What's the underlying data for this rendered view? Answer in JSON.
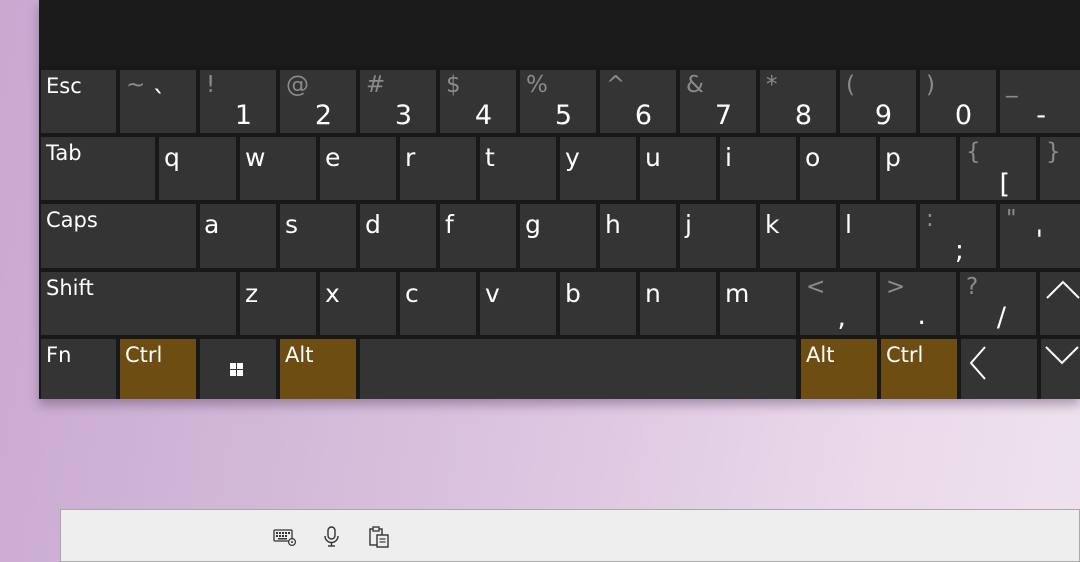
{
  "keyboard": {
    "row1": {
      "esc": "Esc",
      "tilde": {
        "shift": "~",
        "main": "`"
      },
      "k1": {
        "shift": "!",
        "main": "1"
      },
      "k2": {
        "shift": "@",
        "main": "2"
      },
      "k3": {
        "shift": "#",
        "main": "3"
      },
      "k4": {
        "shift": "$",
        "main": "4"
      },
      "k5": {
        "shift": "%",
        "main": "5"
      },
      "k6": {
        "shift": "^",
        "main": "6"
      },
      "k7": {
        "shift": "&",
        "main": "7"
      },
      "k8": {
        "shift": "*",
        "main": "8"
      },
      "k9": {
        "shift": "(",
        "main": "9"
      },
      "k0": {
        "shift": ")",
        "main": "0"
      },
      "minus": {
        "shift": "_",
        "main": "-"
      }
    },
    "row2": {
      "tab": "Tab",
      "letters": [
        "q",
        "w",
        "e",
        "r",
        "t",
        "y",
        "u",
        "i",
        "o",
        "p"
      ],
      "lbracket": {
        "shift": "{",
        "main": "["
      },
      "rbracket": {
        "shift": "}",
        "main": "]"
      }
    },
    "row3": {
      "caps": "Caps",
      "letters": [
        "a",
        "s",
        "d",
        "f",
        "g",
        "h",
        "j",
        "k",
        "l"
      ],
      "semicolon": {
        "shift": ":",
        "main": ";"
      },
      "quote": {
        "shift": "\"",
        "main": "'"
      }
    },
    "row4": {
      "shift": "Shift",
      "letters": [
        "z",
        "x",
        "c",
        "v",
        "b",
        "n",
        "m"
      ],
      "comma": {
        "shift": "<",
        "main": ","
      },
      "period": {
        "shift": ">",
        "main": "."
      },
      "slash": {
        "shift": "?",
        "main": "/"
      }
    },
    "row5": {
      "fn": "Fn",
      "ctrl_left": "Ctrl",
      "alt_left": "Alt",
      "alt_right": "Alt",
      "ctrl_right": "Ctrl"
    },
    "active_modifier_color": "#6e4d12",
    "key_color": "#343434"
  },
  "taskbar": {
    "icons": [
      "keyboard-settings-icon",
      "microphone-icon",
      "clipboard-icon"
    ]
  }
}
